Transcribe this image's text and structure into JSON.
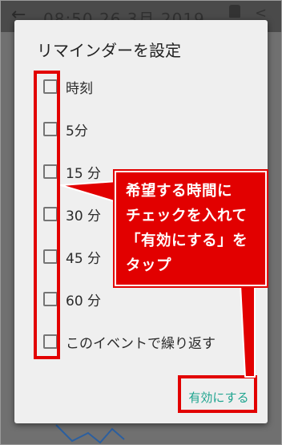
{
  "background_app": {
    "status_title": "08:50  26 3月 2019"
  },
  "dialog": {
    "title": "リマインダーを設定",
    "options": [
      {
        "label": "時刻",
        "checked": false
      },
      {
        "label": "5分",
        "checked": false
      },
      {
        "label": "15 分",
        "checked": false
      },
      {
        "label": "30 分",
        "checked": false
      },
      {
        "label": "45 分",
        "checked": false
      },
      {
        "label": "60 分",
        "checked": false
      },
      {
        "label": "このイベントで繰り返す",
        "checked": false
      }
    ],
    "action_label": "有効にする"
  },
  "annotation": {
    "text": "希望する時間に\nチェックを入れて\n「有効にする」を\nタップ",
    "color": "#e20000"
  },
  "colors": {
    "accent": "#1ea48f",
    "dialog_bg": "#efefef",
    "overlay": "#707070"
  }
}
